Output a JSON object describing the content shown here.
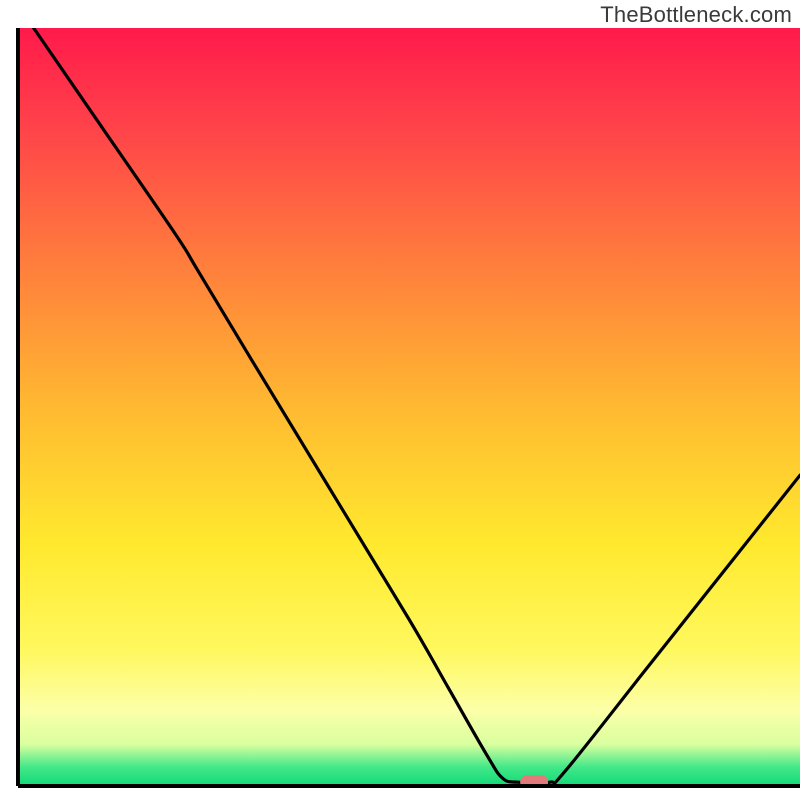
{
  "watermark": "TheBottleneck.com",
  "chart_data": {
    "type": "line",
    "title": "",
    "xlabel": "",
    "ylabel": "",
    "xlim": [
      0,
      100
    ],
    "ylim": [
      0,
      100
    ],
    "x": [
      2,
      10,
      20,
      23,
      30,
      40,
      50,
      55,
      60,
      62,
      64,
      68,
      70,
      80,
      90,
      100
    ],
    "values": [
      100,
      88,
      73,
      68,
      56,
      39,
      22,
      13,
      4,
      1,
      0.5,
      0.5,
      2,
      15,
      28,
      41
    ],
    "marker": {
      "x": 66,
      "y": 0.5
    },
    "gradient_stops": [
      {
        "offset": 0.0,
        "color": "#ff1a4b"
      },
      {
        "offset": 0.12,
        "color": "#ff3f4a"
      },
      {
        "offset": 0.3,
        "color": "#ff7a3d"
      },
      {
        "offset": 0.5,
        "color": "#ffb931"
      },
      {
        "offset": 0.68,
        "color": "#ffe92e"
      },
      {
        "offset": 0.82,
        "color": "#fff85e"
      },
      {
        "offset": 0.9,
        "color": "#fcffa8"
      },
      {
        "offset": 0.945,
        "color": "#d9ff9f"
      },
      {
        "offset": 0.975,
        "color": "#43e889"
      },
      {
        "offset": 1.0,
        "color": "#10d977"
      }
    ],
    "axes": {
      "color": "#000000",
      "width": 4
    }
  }
}
